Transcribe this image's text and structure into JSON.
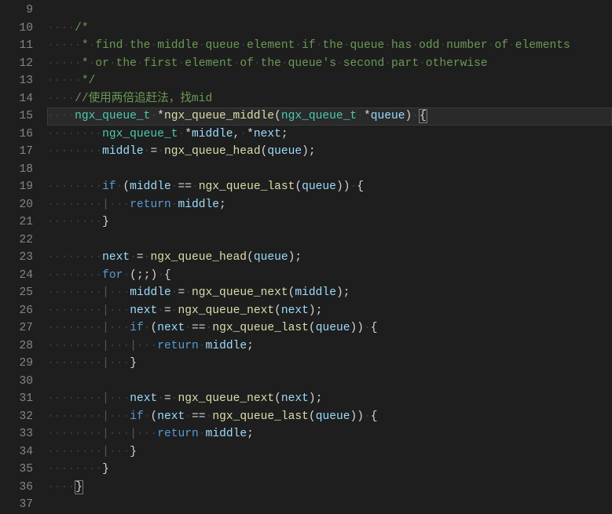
{
  "lineStart": 9,
  "lineEnd": 37,
  "currentLine": 15,
  "whitespaceDot": "·",
  "lines": {
    "l9": {
      "tokens": []
    },
    "l10": {
      "indent": 4,
      "tokens": [
        [
          "comment",
          "/*"
        ]
      ]
    },
    "l11": {
      "indent": 4,
      "tokens": [
        [
          "comment-ws",
          " * find the middle queue element if the queue has odd number of elements"
        ]
      ]
    },
    "l12": {
      "indent": 4,
      "tokens": [
        [
          "comment-ws",
          " * or the first element of the queue's second part otherwise"
        ]
      ]
    },
    "l13": {
      "indent": 4,
      "tokens": [
        [
          "comment-ws",
          " */"
        ]
      ]
    },
    "l14": {
      "indent": 4,
      "tokens": [
        [
          "comment",
          "//使用两倍追赶法，找mid"
        ]
      ]
    },
    "l15": {
      "indent": 4,
      "tokens": [
        [
          "type",
          "ngx_queue_t"
        ],
        [
          "plain",
          " *"
        ],
        [
          "func",
          "ngx_queue_middle"
        ],
        [
          "punc",
          "("
        ],
        [
          "type",
          "ngx_queue_t"
        ],
        [
          "plain",
          " *"
        ],
        [
          "var",
          "queue"
        ],
        [
          "punc",
          ")"
        ],
        [
          "plain",
          " "
        ],
        [
          "brace-open",
          "{"
        ]
      ]
    },
    "l16": {
      "indent": 8,
      "tokens": [
        [
          "type",
          "ngx_queue_t"
        ],
        [
          "plain",
          " *"
        ],
        [
          "var",
          "middle"
        ],
        [
          "punc",
          ","
        ],
        [
          "plain",
          " *"
        ],
        [
          "var",
          "next"
        ],
        [
          "punc",
          ";"
        ]
      ]
    },
    "l17": {
      "indent": 8,
      "tokens": [
        [
          "var",
          "middle"
        ],
        [
          "plain",
          " = "
        ],
        [
          "func",
          "ngx_queue_head"
        ],
        [
          "punc",
          "("
        ],
        [
          "var",
          "queue"
        ],
        [
          "punc",
          ")"
        ],
        [
          "punc",
          ";"
        ]
      ]
    },
    "l18": {
      "tokens": []
    },
    "l19": {
      "indent": 8,
      "tokens": [
        [
          "keyword",
          "if"
        ],
        [
          "plain",
          " "
        ],
        [
          "punc",
          "("
        ],
        [
          "var",
          "middle"
        ],
        [
          "plain",
          " == "
        ],
        [
          "func",
          "ngx_queue_last"
        ],
        [
          "punc",
          "("
        ],
        [
          "var",
          "queue"
        ],
        [
          "punc",
          ")"
        ],
        [
          "punc",
          ")"
        ],
        [
          "plain",
          " "
        ],
        [
          "punc",
          "{"
        ]
      ]
    },
    "l20": {
      "indent": 12,
      "guides": [
        8
      ],
      "tokens": [
        [
          "keyword",
          "return"
        ],
        [
          "plain",
          " "
        ],
        [
          "var",
          "middle"
        ],
        [
          "punc",
          ";"
        ]
      ]
    },
    "l21": {
      "indent": 8,
      "tokens": [
        [
          "punc",
          "}"
        ]
      ]
    },
    "l22": {
      "tokens": []
    },
    "l23": {
      "indent": 8,
      "tokens": [
        [
          "var",
          "next"
        ],
        [
          "plain",
          " = "
        ],
        [
          "func",
          "ngx_queue_head"
        ],
        [
          "punc",
          "("
        ],
        [
          "var",
          "queue"
        ],
        [
          "punc",
          ")"
        ],
        [
          "punc",
          ";"
        ]
      ]
    },
    "l24": {
      "indent": 8,
      "tokens": [
        [
          "keyword",
          "for"
        ],
        [
          "plain",
          " "
        ],
        [
          "punc",
          "("
        ],
        [
          "punc",
          ";"
        ],
        [
          "punc",
          ";"
        ],
        [
          "punc",
          ")"
        ],
        [
          "plain",
          " "
        ],
        [
          "punc",
          "{"
        ]
      ]
    },
    "l25": {
      "indent": 12,
      "guides": [
        8
      ],
      "tokens": [
        [
          "var",
          "middle"
        ],
        [
          "plain",
          " = "
        ],
        [
          "func",
          "ngx_queue_next"
        ],
        [
          "punc",
          "("
        ],
        [
          "var",
          "middle"
        ],
        [
          "punc",
          ")"
        ],
        [
          "punc",
          ";"
        ]
      ]
    },
    "l26": {
      "indent": 12,
      "guides": [
        8
      ],
      "tokens": [
        [
          "var",
          "next"
        ],
        [
          "plain",
          " = "
        ],
        [
          "func",
          "ngx_queue_next"
        ],
        [
          "punc",
          "("
        ],
        [
          "var",
          "next"
        ],
        [
          "punc",
          ")"
        ],
        [
          "punc",
          ";"
        ]
      ]
    },
    "l27": {
      "indent": 12,
      "guides": [
        8
      ],
      "tokens": [
        [
          "keyword",
          "if"
        ],
        [
          "plain",
          " "
        ],
        [
          "punc",
          "("
        ],
        [
          "var",
          "next"
        ],
        [
          "plain",
          " == "
        ],
        [
          "func",
          "ngx_queue_last"
        ],
        [
          "punc",
          "("
        ],
        [
          "var",
          "queue"
        ],
        [
          "punc",
          ")"
        ],
        [
          "punc",
          ")"
        ],
        [
          "plain",
          " "
        ],
        [
          "punc",
          "{"
        ]
      ]
    },
    "l28": {
      "indent": 16,
      "guides": [
        8,
        12
      ],
      "tokens": [
        [
          "keyword",
          "return"
        ],
        [
          "plain",
          " "
        ],
        [
          "var",
          "middle"
        ],
        [
          "punc",
          ";"
        ]
      ]
    },
    "l29": {
      "indent": 12,
      "guides": [
        8
      ],
      "tokens": [
        [
          "punc",
          "}"
        ]
      ]
    },
    "l30": {
      "tokens": []
    },
    "l31": {
      "indent": 12,
      "guides": [
        8
      ],
      "tokens": [
        [
          "var",
          "next"
        ],
        [
          "plain",
          " = "
        ],
        [
          "func",
          "ngx_queue_next"
        ],
        [
          "punc",
          "("
        ],
        [
          "var",
          "next"
        ],
        [
          "punc",
          ")"
        ],
        [
          "punc",
          ";"
        ]
      ]
    },
    "l32": {
      "indent": 12,
      "guides": [
        8
      ],
      "tokens": [
        [
          "keyword",
          "if"
        ],
        [
          "plain",
          " "
        ],
        [
          "punc",
          "("
        ],
        [
          "var",
          "next"
        ],
        [
          "plain",
          " == "
        ],
        [
          "func",
          "ngx_queue_last"
        ],
        [
          "punc",
          "("
        ],
        [
          "var",
          "queue"
        ],
        [
          "punc",
          ")"
        ],
        [
          "punc",
          ")"
        ],
        [
          "plain",
          " "
        ],
        [
          "punc",
          "{"
        ]
      ]
    },
    "l33": {
      "indent": 16,
      "guides": [
        8,
        12
      ],
      "tokens": [
        [
          "keyword",
          "return"
        ],
        [
          "plain",
          " "
        ],
        [
          "var",
          "middle"
        ],
        [
          "punc",
          ";"
        ]
      ]
    },
    "l34": {
      "indent": 12,
      "guides": [
        8
      ],
      "tokens": [
        [
          "punc",
          "}"
        ]
      ]
    },
    "l35": {
      "indent": 8,
      "tokens": [
        [
          "punc",
          "}"
        ]
      ]
    },
    "l36": {
      "indent": 4,
      "tokens": [
        [
          "brace-close",
          "}"
        ]
      ]
    },
    "l37": {
      "tokens": []
    }
  }
}
